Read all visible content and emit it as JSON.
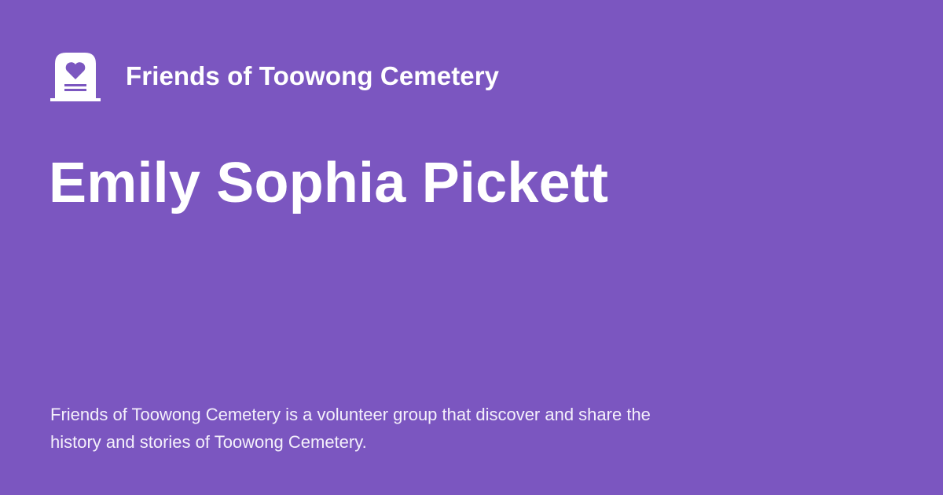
{
  "header": {
    "logo_icon": "tombstone-heart-icon",
    "org_name": "Friends of Toowong Cemetery"
  },
  "title": "Emily Sophia Pickett",
  "description": "Friends of Toowong Cemetery is a volunteer group that discover and share the history and stories of Toowong Cemetery.",
  "colors": {
    "background": "#7b56c0",
    "text": "#ffffff"
  }
}
